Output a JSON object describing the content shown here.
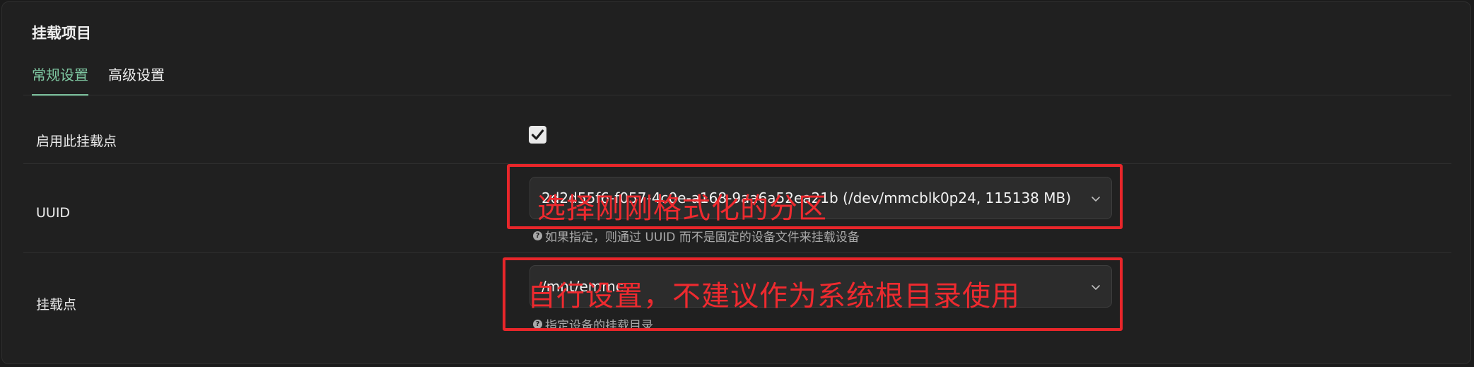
{
  "section": {
    "title": "挂载项目"
  },
  "tabs": [
    {
      "label": "常规设置",
      "active": true
    },
    {
      "label": "高级设置",
      "active": false
    }
  ],
  "rows": {
    "enable": {
      "label": "启用此挂载点",
      "checked": true
    },
    "uuid": {
      "label": "UUID",
      "value": "2d2d55f6-f057-4c0e-a168-9aa6a52ea21b (/dev/mmcblk0p24, 115138 MB)",
      "hint": "如果指定，则通过 UUID 而不是固定的设备文件来挂载设备"
    },
    "mountpoint": {
      "label": "挂载点",
      "value": "/mnt/emmc",
      "hint": "指定设备的挂载目录"
    }
  },
  "annotations": [
    {
      "text": "选择刚刚格式化的分区"
    },
    {
      "text": "自行设置，不建议作为系统根目录使用"
    }
  ],
  "colors": {
    "accent": "#7fc8a2",
    "annotation": "#e8262a",
    "background": "#202020"
  },
  "icons": {
    "checkbox": "check-icon",
    "select": "chevron-down-icon",
    "hint": "question-circle-icon"
  }
}
